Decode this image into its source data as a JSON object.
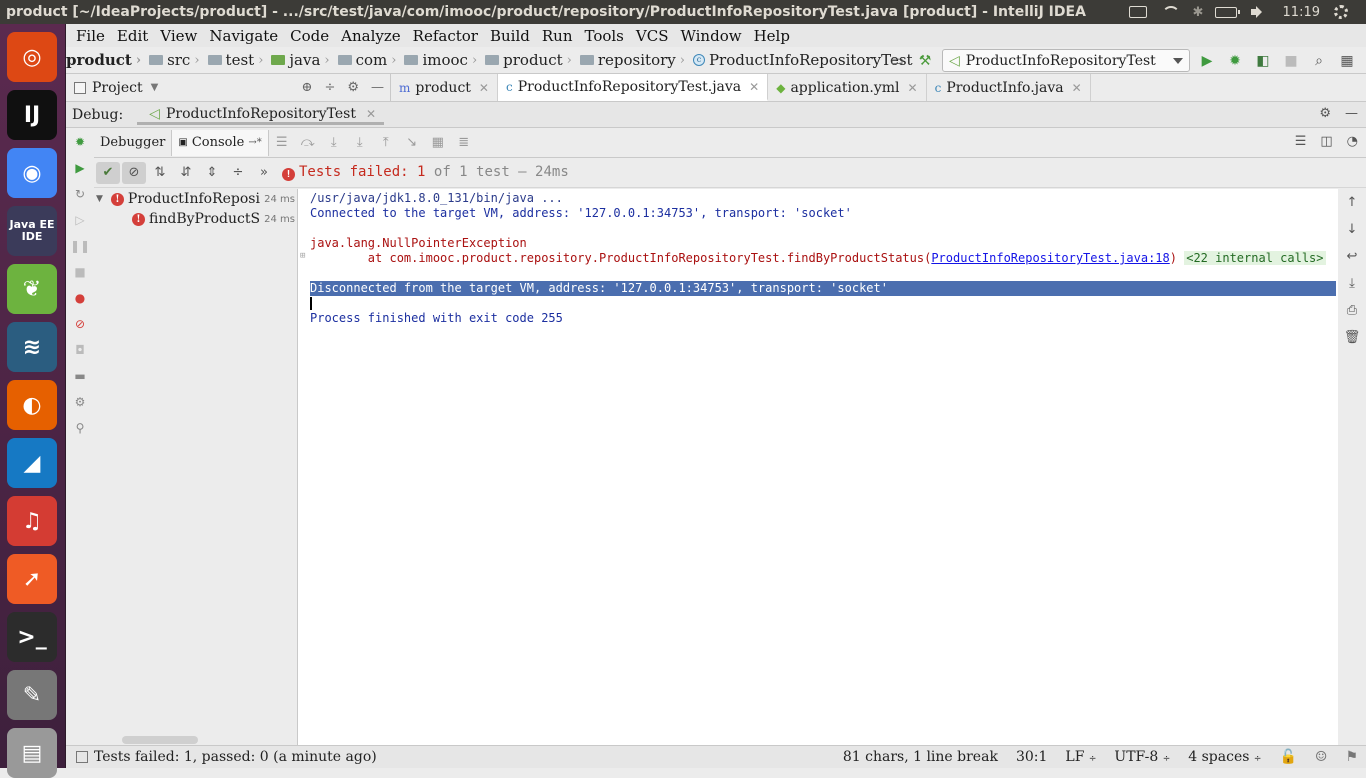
{
  "window": {
    "title": "product [~/IdeaProjects/product] - .../src/test/java/com/imooc/product/repository/ProductInfoRepositoryTest.java [product] - IntelliJ IDEA",
    "clock": "11:19"
  },
  "launcher": {
    "apps": [
      {
        "name": "Ubuntu",
        "glyph": "◎",
        "color": "#dd4814"
      },
      {
        "name": "IntelliJ IDEA",
        "glyph": "IJ",
        "color": "#101010"
      },
      {
        "name": "Chrome",
        "glyph": "◉",
        "color": "#4285f4"
      },
      {
        "name": "Java EE IDE",
        "glyph": "Java EE IDE",
        "color": "#3b3b5a"
      },
      {
        "name": "Spring",
        "glyph": "❦",
        "color": "#6db33f"
      },
      {
        "name": "MySQL Workbench",
        "glyph": "≋",
        "color": "#2b5d80"
      },
      {
        "name": "Firefox",
        "glyph": "◐",
        "color": "#e66000"
      },
      {
        "name": "Wireshark",
        "glyph": "◢",
        "color": "#1679c4"
      },
      {
        "name": "NetEase Music",
        "glyph": "♫",
        "color": "#d43c33"
      },
      {
        "name": "Postman",
        "glyph": "➚",
        "color": "#ef5b25"
      },
      {
        "name": "Terminal",
        "glyph": ">_",
        "color": "#2c2c2c"
      },
      {
        "name": "Text Editor",
        "glyph": "✎",
        "color": "#777"
      },
      {
        "name": "Files",
        "glyph": "▤",
        "color": "#999"
      }
    ]
  },
  "menu": [
    "File",
    "Edit",
    "View",
    "Navigate",
    "Code",
    "Analyze",
    "Refactor",
    "Build",
    "Run",
    "Tools",
    "VCS",
    "Window",
    "Help"
  ],
  "breadcrumb": {
    "project": "product",
    "items": [
      "src",
      "test",
      "java",
      "com",
      "imooc",
      "product",
      "repository"
    ],
    "file": "ProductInfoRepositoryTest"
  },
  "run_config": "ProductInfoRepositoryTest",
  "project_pane": {
    "label": "Project"
  },
  "editor_tabs": [
    {
      "label": "product",
      "active": false
    },
    {
      "label": "ProductInfoRepositoryTest.java",
      "active": true
    },
    {
      "label": "application.yml",
      "active": false
    },
    {
      "label": "ProductInfo.java",
      "active": false
    }
  ],
  "debug": {
    "label": "Debug:",
    "session": "ProductInfoRepositoryTest",
    "tabs": {
      "debugger": "Debugger",
      "console": "Console"
    }
  },
  "tests": {
    "status_prefix": "Tests failed:",
    "failed": "1",
    "of_text": "of 1 test — 24ms",
    "tree": [
      {
        "name": "ProductInfoReposi",
        "time": "24 ms"
      },
      {
        "name": "findByProductS",
        "time": "24 ms"
      }
    ]
  },
  "console": {
    "lines": [
      {
        "text": "/usr/java/jdk1.8.0_131/bin/java ...",
        "style": "cmd"
      },
      {
        "text": "Connected to the target VM, address: '127.0.0.1:34753', transport: 'socket'",
        "style": "info"
      },
      {
        "text": "java.lang.NullPointerException",
        "style": "err"
      },
      {
        "text": "\tat com.imooc.product.repository.ProductInfoRepositoryTest.findByProductStatus(",
        "style": "err"
      },
      {
        "text": "Disconnected from the target VM, address: '127.0.0.1:34753', transport: 'socket'",
        "style": "sel"
      },
      {
        "text": "Process finished with exit code 255",
        "style": "info"
      }
    ],
    "link_text": "ProductInfoRepositoryTest.java:18",
    "close_paren": ")",
    "internal_calls": "<22 internal calls>"
  },
  "statusbar": {
    "message": "Tests failed: 1, passed: 0 (a minute ago)",
    "chars": "81 chars, 1 line break",
    "position": "30:1",
    "line_sep": "LF",
    "encoding": "UTF-8",
    "indent": "4 spaces"
  }
}
